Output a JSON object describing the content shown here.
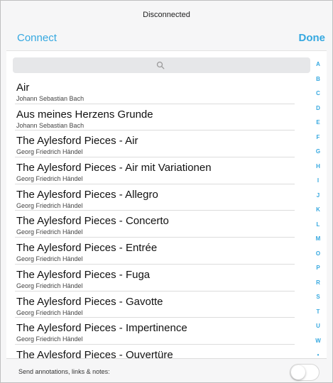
{
  "status": "Disconnected",
  "nav": {
    "left": "Connect",
    "right": "Done"
  },
  "search": {
    "placeholder": ""
  },
  "items": [
    {
      "title": "Air",
      "composer": "Johann Sebastian Bach"
    },
    {
      "title": "Aus meines Herzens Grunde",
      "composer": "Johann Sebastian Bach"
    },
    {
      "title": "The Aylesford Pieces - Air",
      "composer": "Georg Friedrich Händel"
    },
    {
      "title": "The Aylesford Pieces - Air mit Variationen",
      "composer": "Georg Friedrich Händel"
    },
    {
      "title": "The Aylesford Pieces - Allegro",
      "composer": "Georg Friedrich Händel"
    },
    {
      "title": "The Aylesford Pieces - Concerto",
      "composer": "Georg Friedrich Händel"
    },
    {
      "title": "The Aylesford Pieces - Entrée",
      "composer": "Georg Friedrich Händel"
    },
    {
      "title": "The Aylesford Pieces - Fuga",
      "composer": "Georg Friedrich Händel"
    },
    {
      "title": "The Aylesford Pieces - Gavotte",
      "composer": "Georg Friedrich Händel"
    },
    {
      "title": "The Aylesford Pieces - Impertinence",
      "composer": "Georg Friedrich Händel"
    },
    {
      "title": "The Aylesford Pieces - Ouvertüre",
      "composer": ""
    }
  ],
  "index": [
    "A",
    "B",
    "C",
    "D",
    "E",
    "F",
    "G",
    "H",
    "I",
    "J",
    "K",
    "L",
    "M",
    "O",
    "P",
    "R",
    "S",
    "T",
    "U",
    "W",
    "•"
  ],
  "bottom": {
    "label": "Send annotations, links & notes:",
    "toggle_on": false
  },
  "colors": {
    "accent": "#35a8e0"
  },
  "icons": {
    "search": "search-icon"
  }
}
